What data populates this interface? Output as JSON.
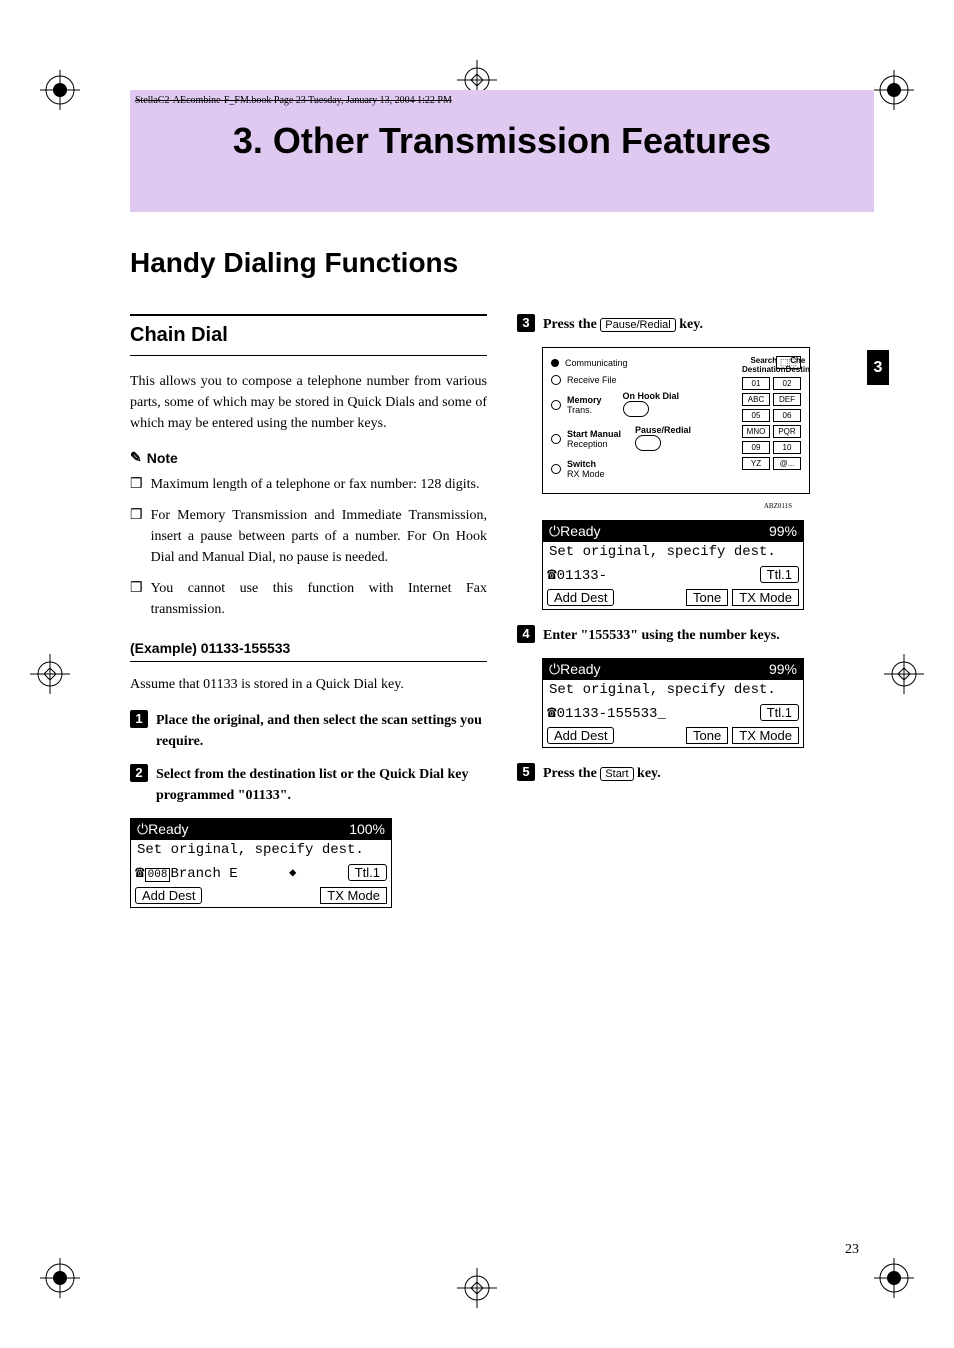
{
  "header_note": "StellaC2-AEcombine-F_FM.book  Page 23  Tuesday, January 13, 2004  1:22 PM",
  "chapter_title": "3. Other Transmission Features",
  "section_title": "Handy Dialing Functions",
  "subsection_title": "Chain Dial",
  "intro_text": "This allows you to compose a telephone number from various parts, some of which may be stored in Quick Dials and some of which may be entered using the number keys.",
  "note_label": "Note",
  "notes": [
    "Maximum length of a telephone or fax number: 128 digits.",
    "For Memory Transmission and Immediate Transmission, insert a pause between parts of a number. For On Hook Dial and Manual Dial, no pause is needed.",
    "You cannot use this function with Internet Fax transmission."
  ],
  "example_header": "(Example) 01133-155533",
  "example_text": "Assume that 01133 is stored in a Quick Dial key.",
  "steps": {
    "s1": "Place the original, and then select the scan settings you require.",
    "s2": "Select from the destination list or the Quick Dial key programmed \"01133\".",
    "s3_pre": "Press the ",
    "s3_key": "Pause/Redial",
    "s3_post": " key.",
    "s4": "Enter \"155533\" using the number keys.",
    "s5_pre": "Press the ",
    "s5_key": "Start",
    "s5_post": " key."
  },
  "lcd1": {
    "status": "Ready",
    "pct": "100%",
    "line2": "Set original, specify dest.",
    "line3_code": "008",
    "line3_text": "Branch E",
    "line3_right": "Ttl.1",
    "btn1": "Add Dest",
    "btn2": "TX Mode"
  },
  "lcd2": {
    "status": "Ready",
    "pct": "99%",
    "line2": "Set original, specify dest.",
    "line3_num": "01133-",
    "line3_right": "Ttl.1",
    "btn1": "Add Dest",
    "btn2": "Tone",
    "btn3": "TX Mode"
  },
  "lcd3": {
    "status": "Ready",
    "pct": "99%",
    "line2": "Set original, specify dest.",
    "line3_num": "01133-155533_",
    "line3_right": "Ttl.1",
    "btn1": "Add Dest",
    "btn2": "Tone",
    "btn3": "TX Mode"
  },
  "panel": {
    "comm": "Communicating",
    "recv": "Receive File",
    "mem": "Memory",
    "trans": "Trans.",
    "onhook": "On Hook Dial",
    "startman": "Start Manual",
    "reception": "Reception",
    "pauseredial": "Pause/Redial",
    "switch": "Switch",
    "rxmode": "RX Mode",
    "search": "Search",
    "dest": "Destination",
    "check": "Che",
    "destin": "Destin",
    "keys": [
      "01",
      "02",
      "ABC",
      "DEF",
      "05",
      "06",
      "MNO",
      "PQR",
      "09",
      "10",
      "YZ",
      "@..."
    ],
    "imgref": "ABZ011S"
  },
  "page_number": "23",
  "section_number": "3"
}
